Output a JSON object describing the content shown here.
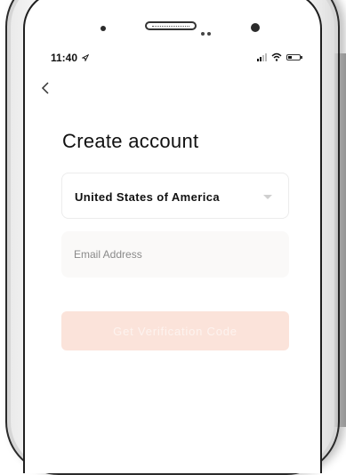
{
  "status_bar": {
    "time": "11:40",
    "location_icon": "location-arrow-icon",
    "signal_icon": "signal-icon",
    "wifi_icon": "wifi-icon",
    "battery_icon": "battery-icon"
  },
  "nav": {
    "back_label": "<"
  },
  "page": {
    "title": "Create account"
  },
  "form": {
    "country": {
      "value": "United States of America",
      "icon": "chevron-down-icon"
    },
    "email": {
      "placeholder": "Email Address",
      "value": ""
    },
    "submit_label": "Get Verification Code"
  },
  "colors": {
    "button_bg": "#fbe3da",
    "button_text": "#fdf3ef",
    "field_bg": "#faf9f8"
  }
}
